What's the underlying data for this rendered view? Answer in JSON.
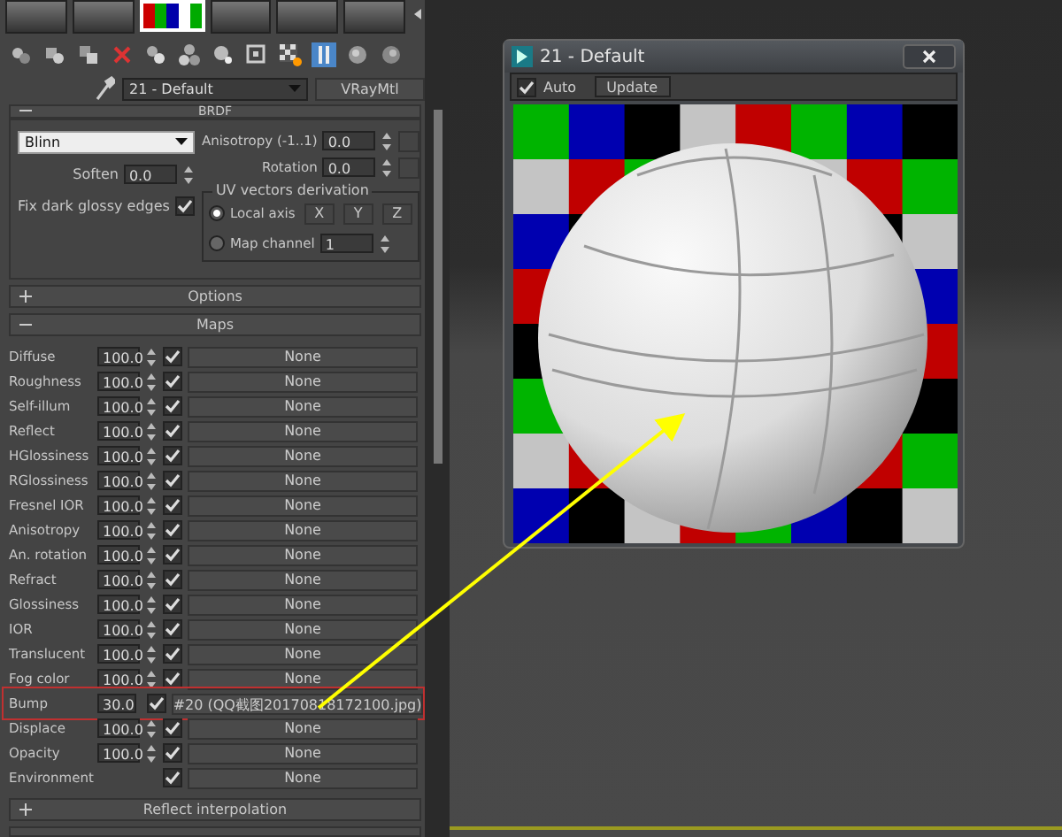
{
  "material": {
    "name": "21 - Default",
    "type": "VRayMtl"
  },
  "brdf": {
    "title": "BRDF",
    "expanded": true,
    "type": "Blinn",
    "anisotropy_label": "Anisotropy (-1..1)",
    "anisotropy": "0.0",
    "rotation_label": "Rotation",
    "rotation": "0.0",
    "soften_label": "Soften",
    "soften": "0.0",
    "fix_label": "Fix dark glossy edges",
    "fix_checked": true,
    "uv_group": "UV vectors derivation",
    "uv_options": [
      {
        "label": "Local axis",
        "selected": true
      },
      {
        "label": "Map channel",
        "selected": false
      }
    ],
    "axes": [
      "X",
      "Y",
      "Z"
    ],
    "map_channel": "1"
  },
  "rollouts_top": [
    {
      "title": "Options",
      "expanded": false
    },
    {
      "title": "Maps",
      "expanded": true
    }
  ],
  "maps": [
    {
      "label": "Diffuse",
      "amount": "100.0",
      "enabled": true,
      "map": "None",
      "highlighted": false
    },
    {
      "label": "Roughness",
      "amount": "100.0",
      "enabled": true,
      "map": "None",
      "highlighted": false
    },
    {
      "label": "Self-illum",
      "amount": "100.0",
      "enabled": true,
      "map": "None",
      "highlighted": false
    },
    {
      "label": "Reflect",
      "amount": "100.0",
      "enabled": true,
      "map": "None",
      "highlighted": false
    },
    {
      "label": "HGlossiness",
      "amount": "100.0",
      "enabled": true,
      "map": "None",
      "highlighted": false
    },
    {
      "label": "RGlossiness",
      "amount": "100.0",
      "enabled": true,
      "map": "None",
      "highlighted": false
    },
    {
      "label": "Fresnel IOR",
      "amount": "100.0",
      "enabled": true,
      "map": "None",
      "highlighted": false
    },
    {
      "label": "Anisotropy",
      "amount": "100.0",
      "enabled": true,
      "map": "None",
      "highlighted": false
    },
    {
      "label": "An. rotation",
      "amount": "100.0",
      "enabled": true,
      "map": "None",
      "highlighted": false
    },
    {
      "label": "Refract",
      "amount": "100.0",
      "enabled": true,
      "map": "None",
      "highlighted": false
    },
    {
      "label": "Glossiness",
      "amount": "100.0",
      "enabled": true,
      "map": "None",
      "highlighted": false
    },
    {
      "label": "IOR",
      "amount": "100.0",
      "enabled": true,
      "map": "None",
      "highlighted": false
    },
    {
      "label": "Translucent",
      "amount": "100.0",
      "enabled": true,
      "map": "None",
      "highlighted": false
    },
    {
      "label": "Fog color",
      "amount": "100.0",
      "enabled": true,
      "map": "None",
      "highlighted": false
    },
    {
      "label": "Bump",
      "amount": "30.0",
      "enabled": true,
      "map": "#20 (QQ截图20170818172100.jpg)",
      "highlighted": true
    },
    {
      "label": "Displace",
      "amount": "100.0",
      "enabled": true,
      "map": "None",
      "highlighted": false
    },
    {
      "label": "Opacity",
      "amount": "100.0",
      "enabled": true,
      "map": "None",
      "highlighted": false
    },
    {
      "label": "Environment",
      "enabled": true,
      "map": "None",
      "highlighted": false
    }
  ],
  "rollouts_bottom": [
    {
      "title": "Reflect interpolation",
      "expanded": false
    }
  ],
  "preview": {
    "title": "21 - Default",
    "auto_label": "Auto",
    "auto": true,
    "update": "Update"
  }
}
